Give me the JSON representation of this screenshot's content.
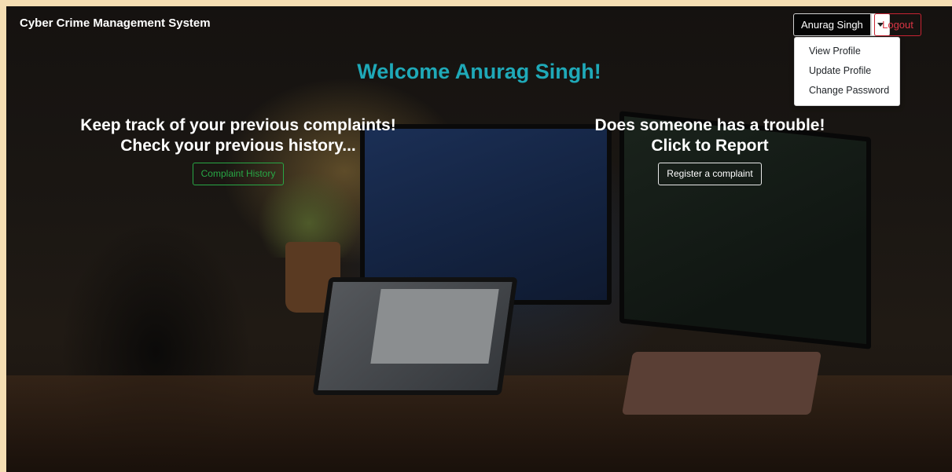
{
  "navbar": {
    "brand": "Cyber Crime Management System",
    "user_label": "Anurag Singh",
    "logout_label": "Logout"
  },
  "dropdown": {
    "items": [
      {
        "label": "View Profile"
      },
      {
        "label": "Update Profile"
      },
      {
        "label": "Change Password"
      }
    ]
  },
  "main": {
    "welcome": "Welcome Anurag Singh!",
    "history": {
      "line1": "Keep track of your previous complaints!",
      "line2": "Check your previous history...",
      "button": "Complaint History"
    },
    "report": {
      "line1": "Does someone has a trouble!",
      "line2": "Click to Report",
      "button": "Register a complaint"
    }
  },
  "colors": {
    "welcome": "#1fa9b8",
    "history_button": "#28a745",
    "logout": "#dc3545"
  },
  "icons": {
    "caret": "caret-down-icon"
  }
}
